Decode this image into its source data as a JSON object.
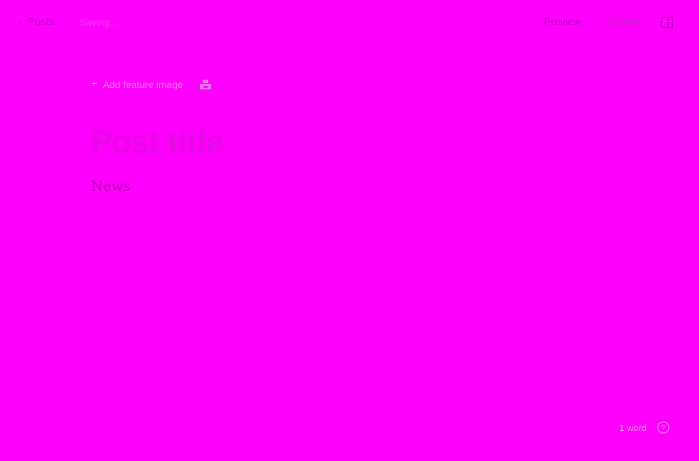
{
  "header": {
    "back_label": "Posts",
    "status_text": "Saving...",
    "preview_label": "Preview",
    "publish_label": "Publish"
  },
  "editor": {
    "add_feature_label": "Add feature image",
    "title_placeholder": "Post title",
    "body_text": "News"
  },
  "footer": {
    "word_count": "1 word"
  },
  "icons": {
    "back": "chevron-left-icon",
    "add": "plus-icon",
    "unsplash": "unsplash-icon",
    "sidebar": "sidebar-toggle-icon",
    "help": "help-icon"
  },
  "colors": {
    "background": "#ff00ff",
    "primary_text": "#c000c0",
    "muted_text": "#e63fe6",
    "title_placeholder": "#e60ae6"
  }
}
